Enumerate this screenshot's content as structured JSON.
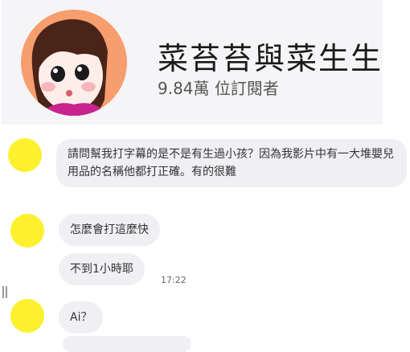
{
  "channel": {
    "name": "菜苔苔與菜生生",
    "subscribers": "9.84萬 位訂閱者",
    "avatar_bg": "#f79e6e"
  },
  "chat": {
    "avatar_color": "#fdf02e",
    "bubble_color": "#f0eff3",
    "messages": [
      {
        "text": "請問幫我打字幕的是不是有生過小孩？因為我影片中有一大堆嬰兒用品的名稱他都打正確。有的很難"
      },
      {
        "text": "怎麼會打這麼快"
      },
      {
        "text": "不到1小時耶",
        "time": "17:22"
      },
      {
        "text": "Ai？"
      }
    ]
  }
}
